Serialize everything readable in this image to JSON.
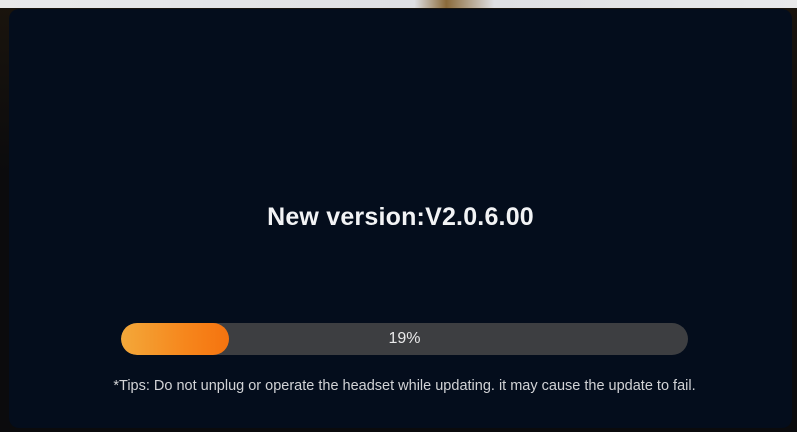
{
  "dialog": {
    "title": "New version:V2.0.6.00",
    "progress": {
      "percent": 19,
      "label": "19%"
    },
    "tips": "*Tips: Do not unplug or operate the headset while updating. it may cause the update to fail."
  },
  "colors": {
    "dialog_background": "#040d1c",
    "progress_track": "#3d3e41",
    "progress_fill_start": "#f3a83a",
    "progress_fill_end": "#f5730f"
  }
}
